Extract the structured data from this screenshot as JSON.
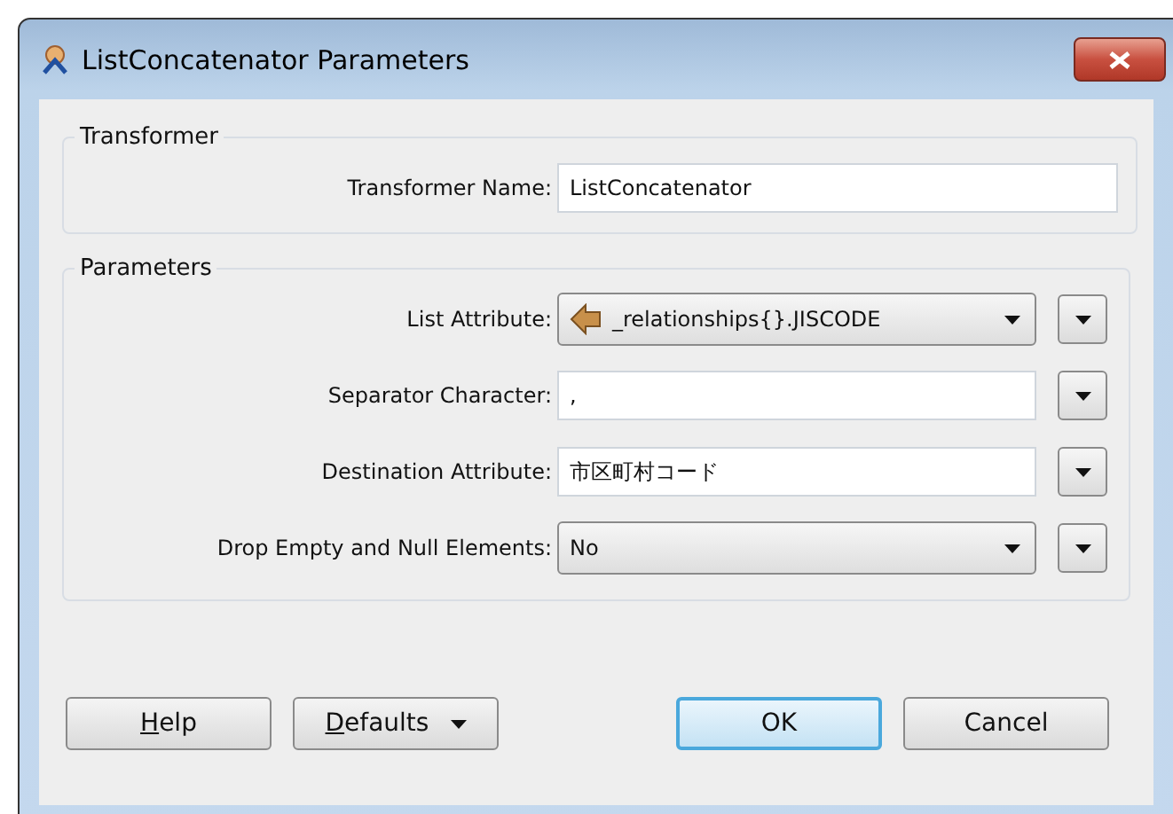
{
  "window": {
    "title": "ListConcatenator Parameters"
  },
  "transformer": {
    "legend": "Transformer",
    "label": "Transformer Name:",
    "value": "ListConcatenator"
  },
  "parameters": {
    "legend": "Parameters",
    "rows": [
      {
        "kind": "attribute-dropdown",
        "label": "List Attribute:",
        "value": "_relationships{}.JISCODE"
      },
      {
        "kind": "text",
        "label": "Separator Character:",
        "value": ","
      },
      {
        "kind": "text",
        "label": "Destination Attribute:",
        "value": "市区町村コード"
      },
      {
        "kind": "dropdown",
        "label": "Drop Empty and Null Elements:",
        "value": "No"
      }
    ]
  },
  "buttons": [
    {
      "label": "Help",
      "underline_first": true,
      "menu": false,
      "default": false
    },
    {
      "label": "Defaults",
      "underline_first": true,
      "menu": true,
      "default": false
    },
    {
      "label": "OK",
      "underline_first": false,
      "menu": false,
      "default": true
    },
    {
      "label": "Cancel",
      "underline_first": false,
      "menu": false,
      "default": false
    }
  ]
}
